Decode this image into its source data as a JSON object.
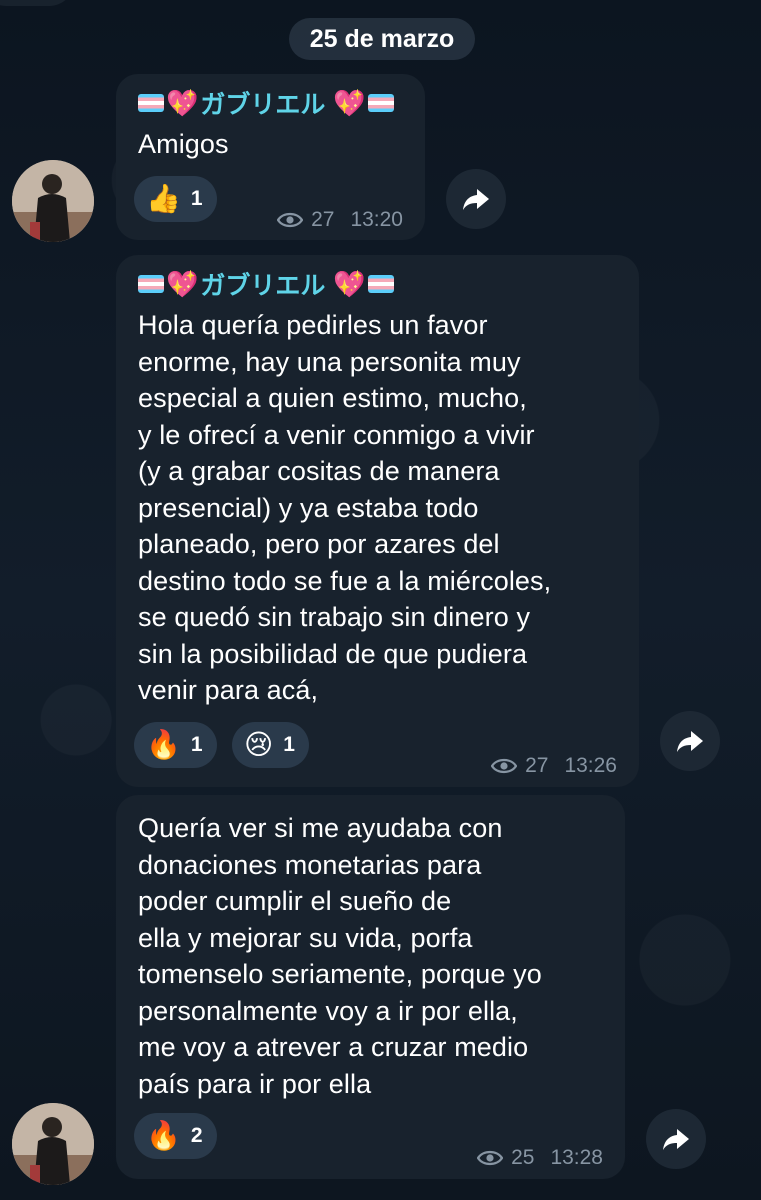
{
  "date_label": "25 de marzo",
  "sender_name": "ガブリエル",
  "messages": [
    {
      "show_sender": true,
      "text": "Amigos",
      "reactions": [
        {
          "emoji": "👍",
          "count": "1",
          "icon": "thumbs-up-emoji"
        }
      ],
      "views": "27",
      "time": "13:20"
    },
    {
      "show_sender": true,
      "text": "Hola quería pedirles un favor\nenorme, hay una personita muy\nespecial a quien estimo, mucho,\ny le ofrecí a venir conmigo a vivir\n(y a grabar cositas de manera\npresencial) y ya estaba todo\nplaneado, pero por azares del\ndestino todo se fue a la miércoles,\nse quedó sin trabajo sin dinero y\nsin la posibilidad de que pudiera\nvenir para acá,",
      "reactions": [
        {
          "emoji": "🔥",
          "count": "1",
          "icon": "fire-emoji"
        },
        {
          "emoji": "😢",
          "count": "1",
          "icon": "crying-face-emoji"
        }
      ],
      "views": "27",
      "time": "13:26"
    },
    {
      "show_sender": false,
      "text": "Quería ver si me ayudaba con\ndonaciones monetarias para\npoder cumplir el sueño de\nella y mejorar su vida, porfa\ntomenselo seriamente, porque yo\npersonalmente voy a ir por ella,\nme voy a atrever a cruzar medio\npaís para ir por ella",
      "reactions": [
        {
          "emoji": "🔥",
          "count": "2",
          "icon": "fire-emoji"
        }
      ],
      "views": "25",
      "time": "13:28"
    }
  ],
  "colors": {
    "background": "#0e1621",
    "bubble": "#18222d",
    "sender_name": "#5fd4e8",
    "meta_text": "#8795a3",
    "reaction_pill": "#2a3a4b"
  }
}
